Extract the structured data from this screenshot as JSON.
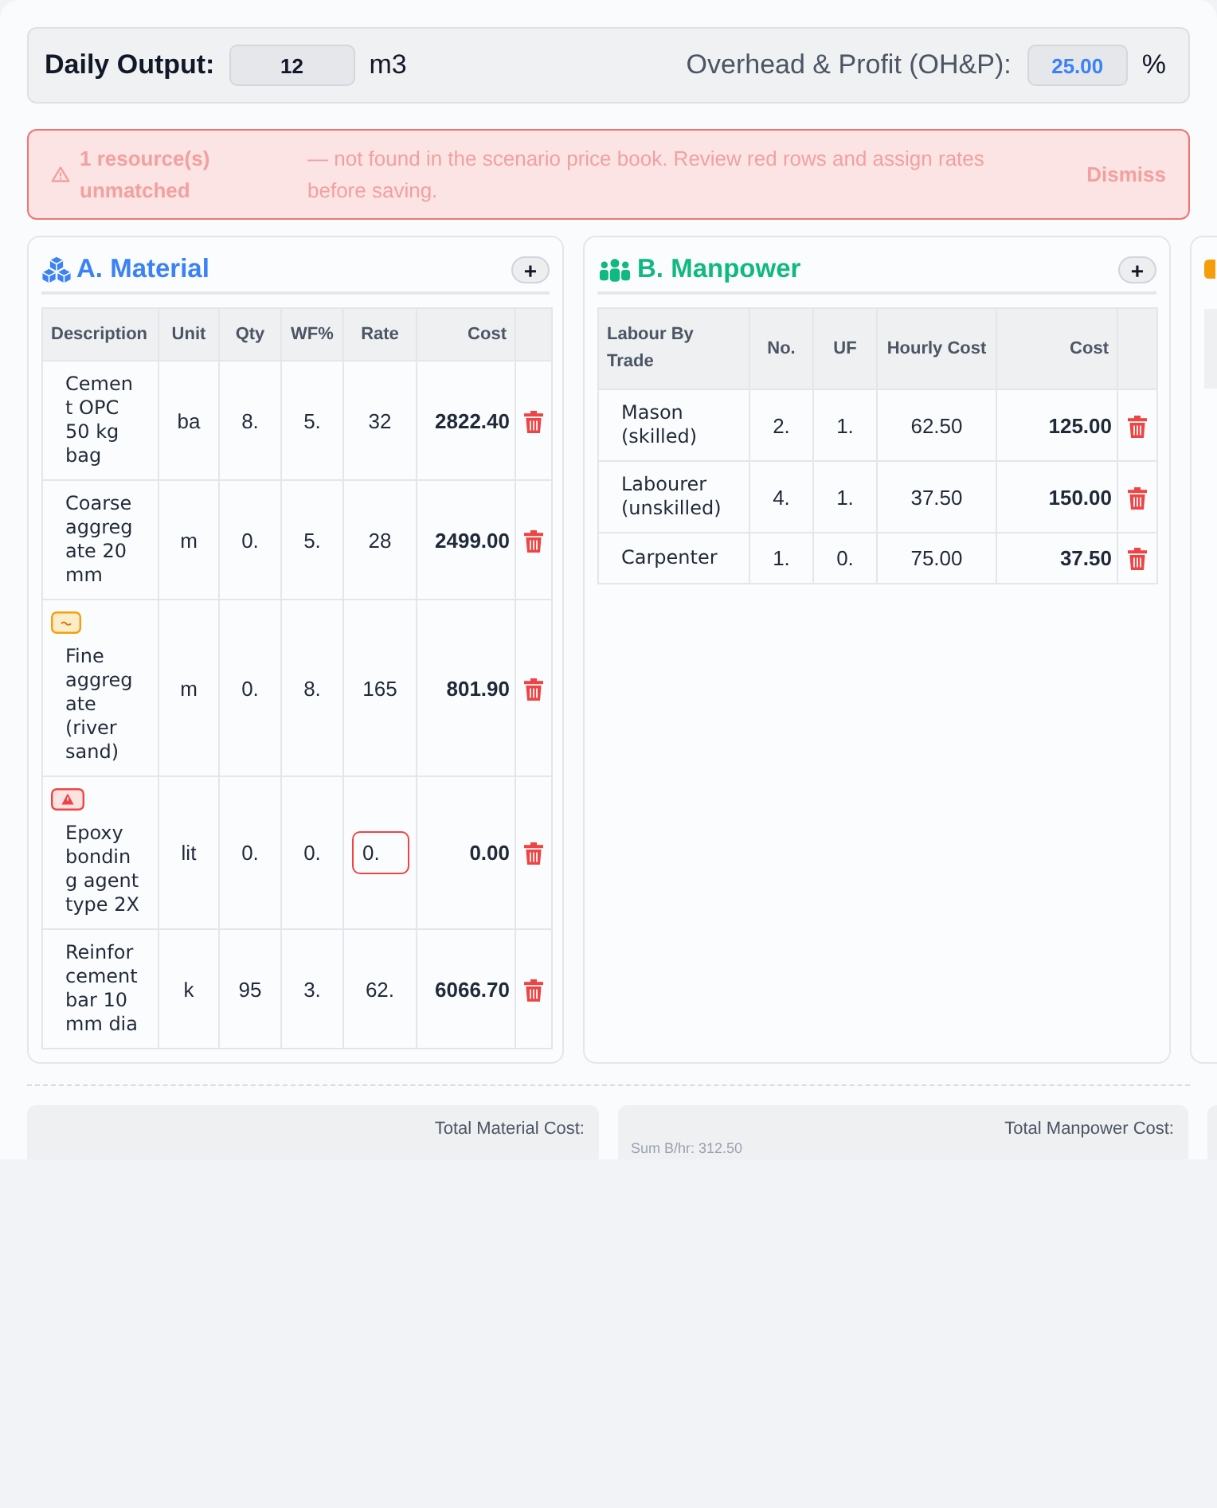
{
  "daily_output": {
    "label": "Daily Output:",
    "value": "12",
    "unit": "m3"
  },
  "overhead_profit": {
    "label": "Overhead & Profit (OH&P):",
    "value": "25.00",
    "unit": "%"
  },
  "alert": {
    "title": "1 resource(s) unmatched",
    "message": "— not found in the scenario price book. Review red rows and assign rates before saving.",
    "action": "Dismiss"
  },
  "material": {
    "title": "A. Material",
    "add_label": "+",
    "columns": [
      "Description",
      "Unit",
      "Qty",
      "WF%",
      "Rate",
      "Cost"
    ],
    "rows": [
      {
        "fuzzy_match": false,
        "unmatched": false,
        "description": "Cement OPC 50 kg bag",
        "unit": "ba",
        "qty": "8.",
        "wf": "5.",
        "rate": "32",
        "cost": "2822.40"
      },
      {
        "fuzzy_match": false,
        "unmatched": false,
        "description": "Coarse aggregate 20 mm",
        "unit": "m",
        "qty": "0.",
        "wf": "5.",
        "rate": "28",
        "cost": "2499.00"
      },
      {
        "fuzzy_match": true,
        "unmatched": false,
        "description": "Fine aggregate (river sand)",
        "unit": "m",
        "qty": "0.",
        "wf": "8.",
        "rate": "165",
        "cost": "801.90"
      },
      {
        "fuzzy_match": false,
        "unmatched": true,
        "description": "Epoxy bonding agent type 2X",
        "unit": "lit",
        "qty": "0.",
        "wf": "0.",
        "rate": "0.",
        "cost": "0.00"
      },
      {
        "fuzzy_match": false,
        "unmatched": false,
        "description": "Reinforcement bar 10 mm dia",
        "unit": "k",
        "qty": "95",
        "wf": "3.",
        "rate": "62.",
        "cost": "6066.70"
      }
    ]
  },
  "manpower": {
    "title": "B. Manpower",
    "add_label": "+",
    "columns": [
      "Labour By Trade",
      "No.",
      "UF",
      "Hourly Cost",
      "Cost"
    ],
    "rows": [
      {
        "trade": "Mason (skilled)",
        "number": "2.",
        "uf": "1.",
        "hourly_cost": "62.50",
        "cost": "125.00"
      },
      {
        "trade": "Labourer (unskilled)",
        "number": "4.",
        "uf": "1.",
        "hourly_cost": "37.50",
        "cost": "150.00"
      },
      {
        "trade": "Carpenter",
        "number": "1.",
        "uf": "0.",
        "hourly_cost": "75.00",
        "cost": "37.50"
      }
    ]
  },
  "totals": [
    {
      "label": "Total Material Cost:"
    },
    {
      "label": "Total Manpower Cost:",
      "note": "Sum B/hr: 312.50"
    }
  ]
}
